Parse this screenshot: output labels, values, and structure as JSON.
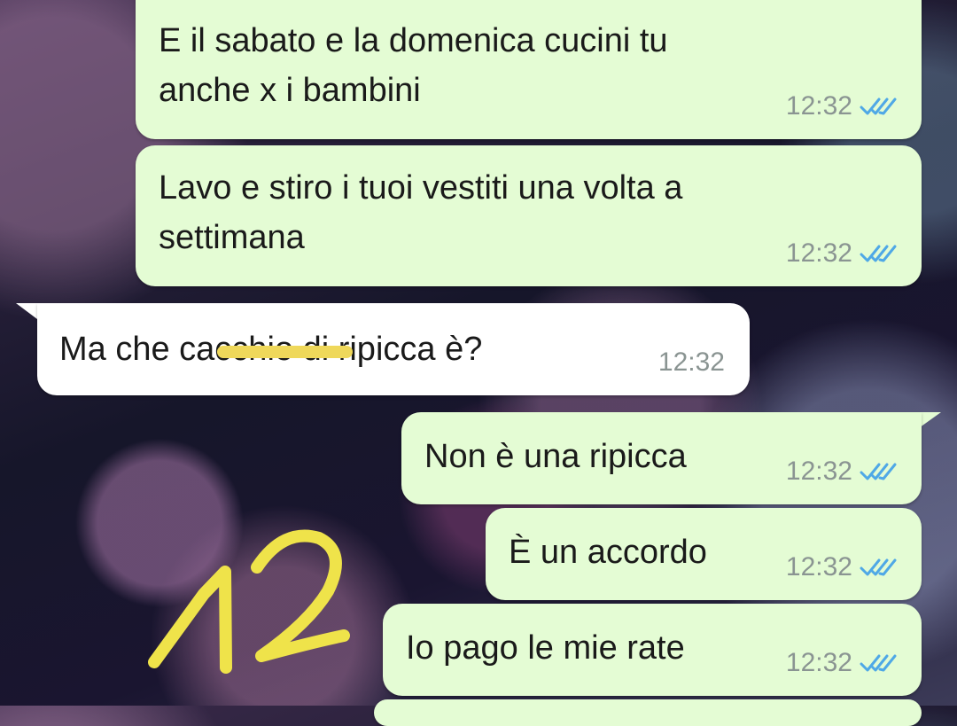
{
  "messages": [
    {
      "id": "m1",
      "direction": "outgoing",
      "lines": [
        "E il sabato e la domenica cucini tu",
        "anche x i bambini"
      ],
      "time": "12:32",
      "status": "read"
    },
    {
      "id": "m2",
      "direction": "outgoing",
      "lines": [
        "Lavo e stiro i tuoi vestiti una volta a",
        "settimana"
      ],
      "time": "12:32",
      "status": "read"
    },
    {
      "id": "m3",
      "direction": "incoming",
      "text_before": "Ma che ",
      "text_censored": "cacchio",
      "text_after": " di ripicca è?",
      "time": "12:32"
    },
    {
      "id": "m4",
      "direction": "outgoing",
      "lines": [
        "Non è una ripicca"
      ],
      "time": "12:32",
      "status": "read"
    },
    {
      "id": "m5",
      "direction": "outgoing",
      "lines": [
        "È un accordo"
      ],
      "time": "12:32",
      "status": "read"
    },
    {
      "id": "m6",
      "direction": "outgoing",
      "lines": [
        "Io pago le mie rate"
      ],
      "time": "12:32",
      "status": "read"
    }
  ],
  "annotation": {
    "handwritten": "12",
    "color": "#efe34a"
  },
  "colors": {
    "outgoing_bubble": "#e4fcd4",
    "incoming_bubble": "#ffffff",
    "read_ticks": "#4fa8e6",
    "time_text": "#8a9492"
  }
}
